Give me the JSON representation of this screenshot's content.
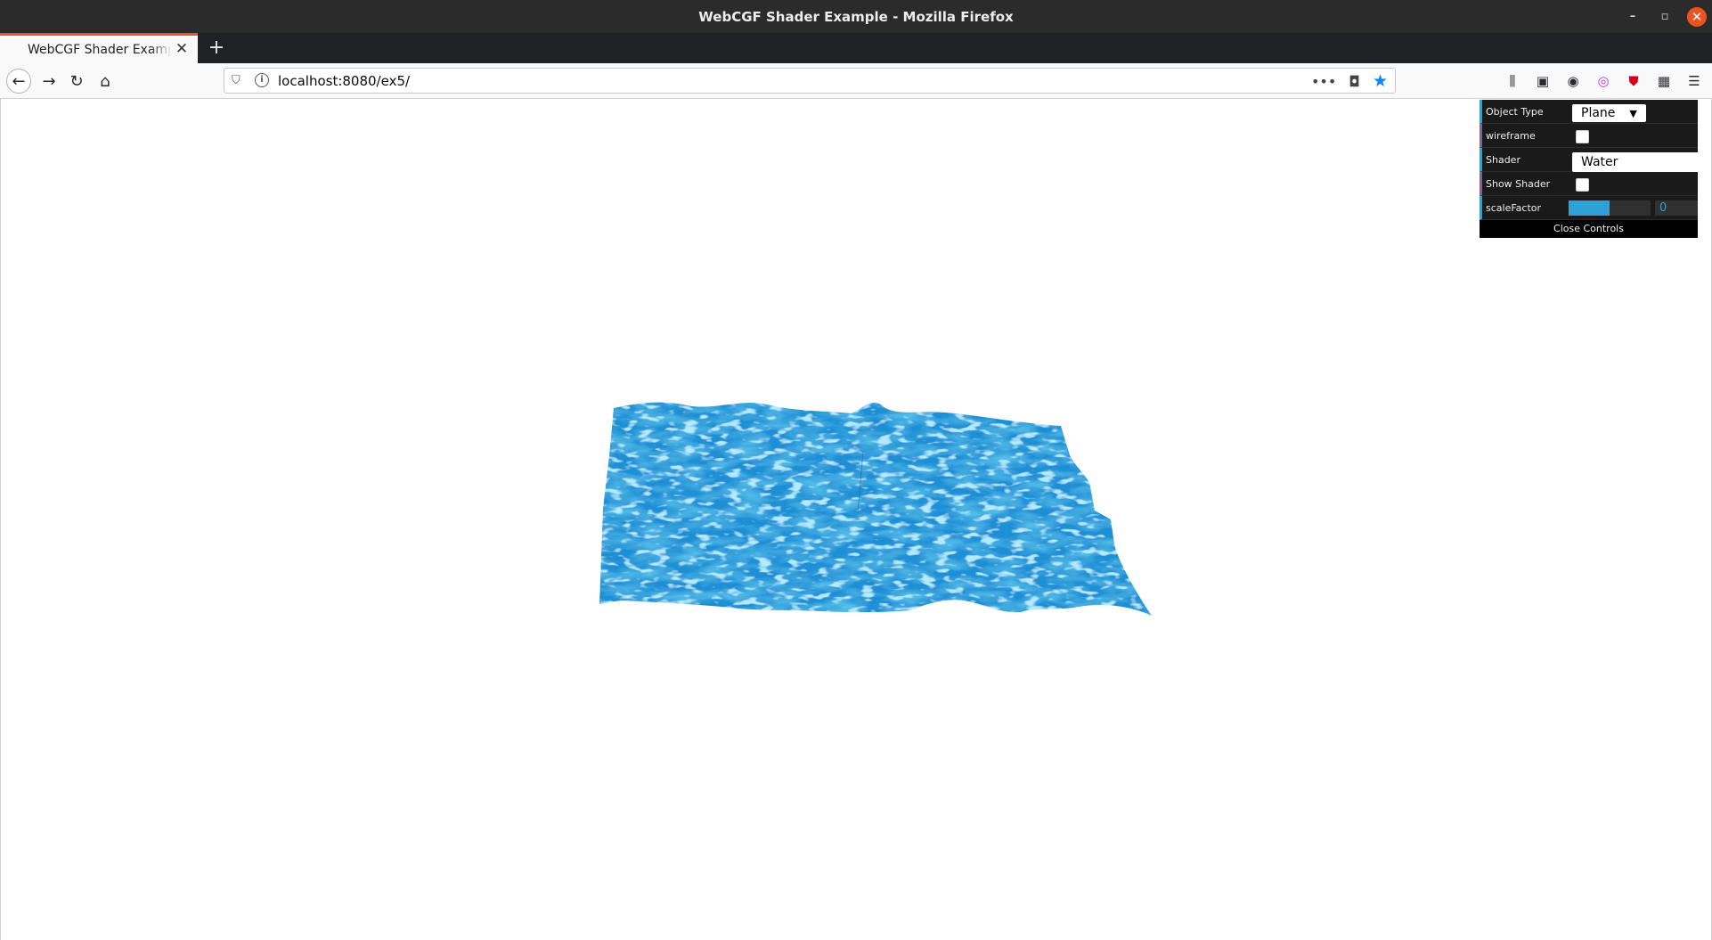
{
  "window": {
    "title": "WebCGF Shader Example - Mozilla Firefox",
    "minimize_glyph": "–",
    "restore_glyph": "▫",
    "close_glyph": "✕"
  },
  "tabs": [
    {
      "title": "WebCGF Shader Example",
      "active": true
    }
  ],
  "tab_close_glyph": "✕",
  "new_tab_glyph": "+",
  "nav": {
    "back_glyph": "←",
    "forward_glyph": "→",
    "reload_glyph": "↻",
    "home_glyph": "⌂"
  },
  "urlbar": {
    "url": "localhost:8080/ex5/",
    "more_glyph": "•••",
    "pocket_glyph": "◘",
    "bookmark_glyph": "★"
  },
  "toolbar_icons": {
    "library": "⫼",
    "sidebar": "▣",
    "account": "◉",
    "addon": "◎",
    "shield": "⛊",
    "extensions": "▦",
    "menu": "☰"
  },
  "colors": {
    "water": "#1a8fd6",
    "accent": "#2fa1d6",
    "ubuntu_orange": "#e95420"
  },
  "gui": {
    "object_type": {
      "label": "Object Type",
      "value": "Plane"
    },
    "wireframe": {
      "label": "wireframe",
      "checked": false
    },
    "shader": {
      "label": "Shader",
      "value": "Water"
    },
    "show_shader": {
      "label": "Show Shader",
      "checked": false
    },
    "scale_factor": {
      "label": "scaleFactor",
      "value": "0",
      "fill_fraction": 0.5
    },
    "close_label": "Close Controls"
  }
}
